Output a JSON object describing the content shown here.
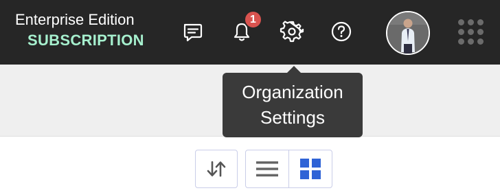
{
  "header": {
    "edition_title": "Enterprise Edition",
    "edition_subtitle": "SUBSCRIPTION",
    "notification_count": "1",
    "icons": [
      "message-icon",
      "bell-icon",
      "gear-icon",
      "help-icon",
      "avatar",
      "apps-grid-icon"
    ]
  },
  "tooltip": {
    "line1": "Organization",
    "line2": "Settings"
  },
  "toolbar": {
    "buttons": [
      "sort-icon",
      "list-view-icon",
      "grid-view-icon"
    ],
    "active_view": "grid"
  },
  "colors": {
    "topbar": "#262626",
    "subtitle": "#a6f0ce",
    "badge": "#d9534f",
    "accent": "#2f63d6",
    "tooltip": "#3a3a3a"
  }
}
